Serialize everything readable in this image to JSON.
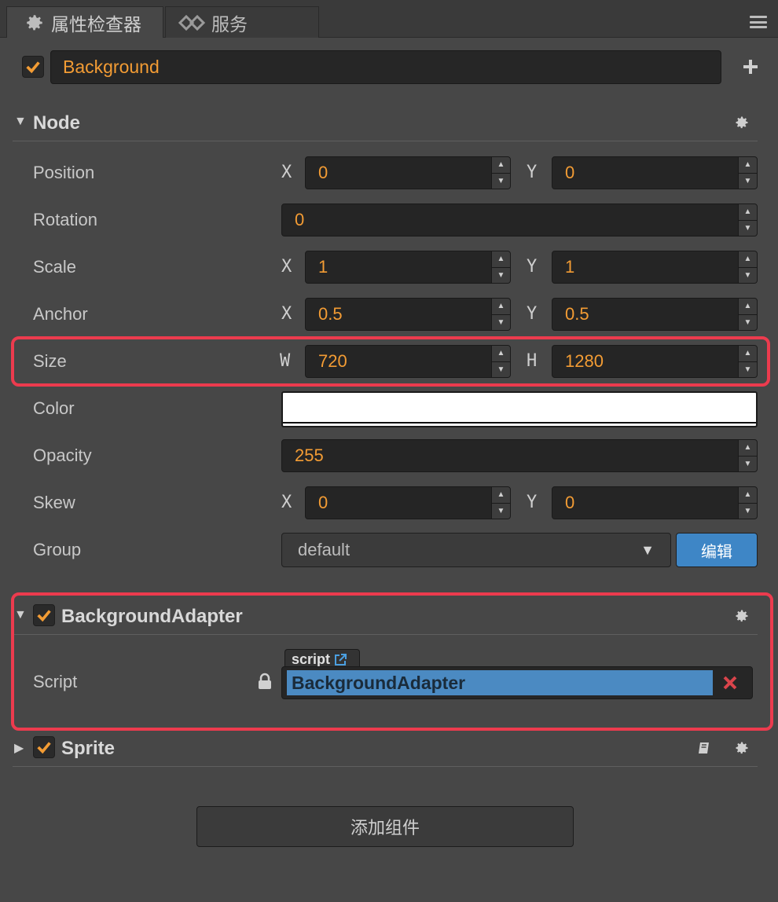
{
  "tabs": [
    {
      "label": "属性检查器",
      "icon": "gear-icon"
    },
    {
      "label": "服务",
      "icon": "service-icon"
    }
  ],
  "node_name": {
    "enabled": true,
    "value": "Background"
  },
  "node_section": {
    "title": "Node",
    "position": {
      "label": "Position",
      "x_axis": "X",
      "x": "0",
      "y_axis": "Y",
      "y": "0"
    },
    "rotation": {
      "label": "Rotation",
      "value": "0"
    },
    "scale": {
      "label": "Scale",
      "x_axis": "X",
      "x": "1",
      "y_axis": "Y",
      "y": "1"
    },
    "anchor": {
      "label": "Anchor",
      "x_axis": "X",
      "x": "0.5",
      "y_axis": "Y",
      "y": "0.5"
    },
    "size": {
      "label": "Size",
      "w_axis": "W",
      "w": "720",
      "h_axis": "H",
      "h": "1280"
    },
    "color": {
      "label": "Color",
      "value_hex": "#ffffff"
    },
    "opacity": {
      "label": "Opacity",
      "value": "255"
    },
    "skew": {
      "label": "Skew",
      "x_axis": "X",
      "x": "0",
      "y_axis": "Y",
      "y": "0"
    },
    "group": {
      "label": "Group",
      "value": "default",
      "edit_label": "编辑"
    }
  },
  "background_adapter": {
    "title": "BackgroundAdapter",
    "enabled": true,
    "script_label": "Script",
    "script_tag": "script",
    "script_value": "BackgroundAdapter"
  },
  "sprite": {
    "title": "Sprite",
    "enabled": true
  },
  "add_component_label": "添加组件",
  "colors": {
    "accent": "#f39c34",
    "highlight": "#ec3b4e",
    "button_blue": "#3e86c6",
    "script_blue": "#4b8ac2"
  }
}
